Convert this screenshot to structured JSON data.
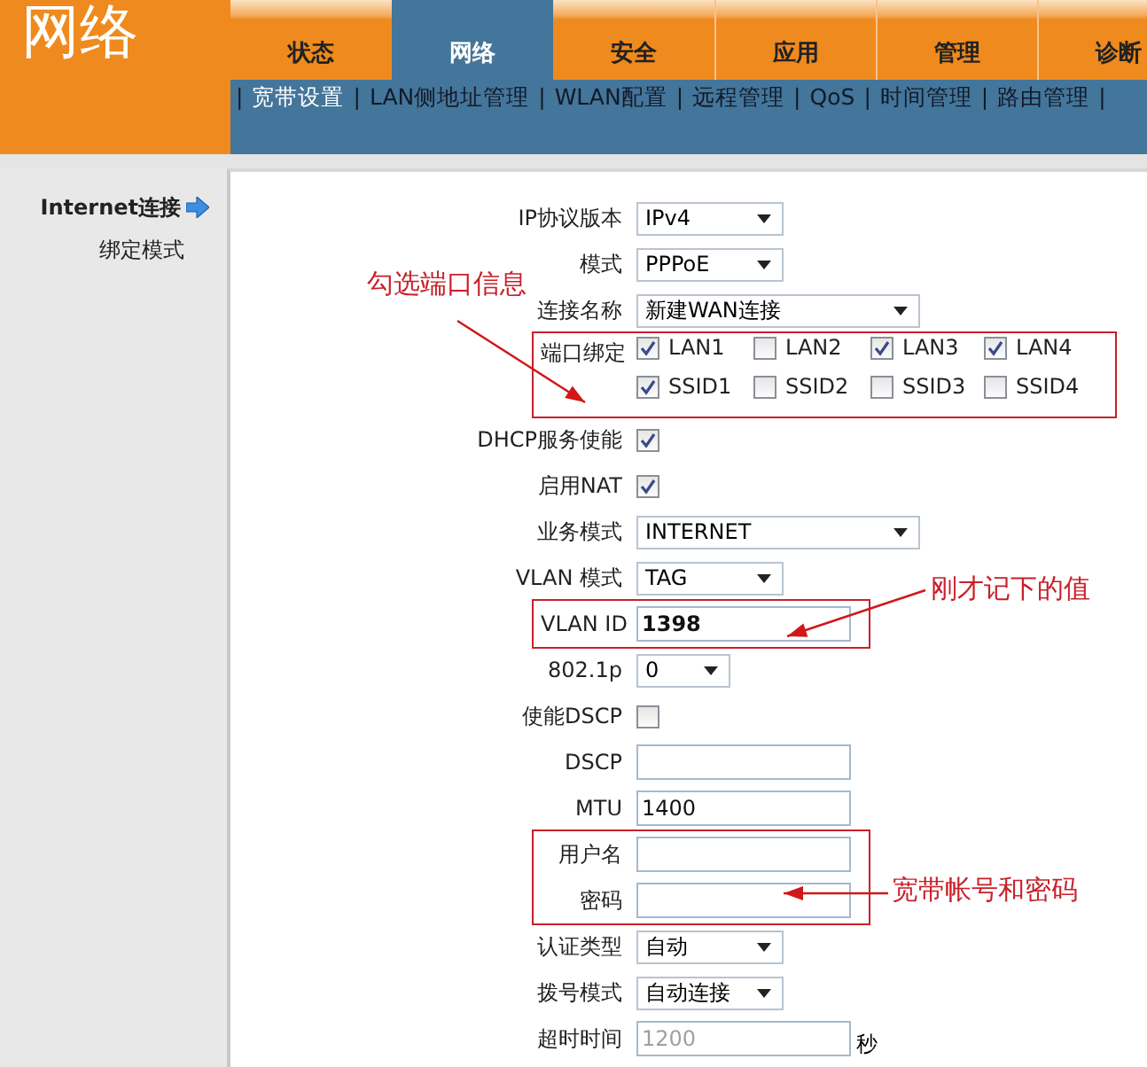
{
  "logo": {
    "title": "网络"
  },
  "tabs": [
    {
      "label": "状态",
      "selected": false
    },
    {
      "label": "网络",
      "selected": true
    },
    {
      "label": "安全",
      "selected": false
    },
    {
      "label": "应用",
      "selected": false
    },
    {
      "label": "管理",
      "selected": false
    },
    {
      "label": "诊断",
      "selected": false
    }
  ],
  "subnav": {
    "separator": "|",
    "items": [
      {
        "label": "宽带设置",
        "selected": true
      },
      {
        "label": "LAN侧地址管理",
        "selected": false
      },
      {
        "label": "WLAN配置",
        "selected": false
      },
      {
        "label": "远程管理",
        "selected": false
      },
      {
        "label": "QoS",
        "selected": false
      },
      {
        "label": "时间管理",
        "selected": false
      },
      {
        "label": "路由管理",
        "selected": false
      }
    ]
  },
  "sidebar": {
    "items": [
      {
        "label": "Internet连接",
        "selected": true
      },
      {
        "label": "绑定模式",
        "selected": false
      }
    ]
  },
  "form": {
    "groups": [
      {
        "highlighted": false,
        "rows": [
          {
            "kind": "select",
            "label": "IP协议版本",
            "value": "IPv4"
          },
          {
            "kind": "select",
            "label": "模式",
            "value": "PPPoE"
          },
          {
            "kind": "select",
            "label": "连接名称",
            "value": "新建WAN连接"
          }
        ]
      },
      {
        "highlighted": true,
        "rows": [
          {
            "kind": "checkboxes",
            "label": "端口绑定",
            "options": [
              {
                "label": "LAN1",
                "checked": true
              },
              {
                "label": "LAN2",
                "checked": false
              },
              {
                "label": "LAN3",
                "checked": true
              },
              {
                "label": "LAN4",
                "checked": true
              },
              {
                "label": "SSID1",
                "checked": true
              },
              {
                "label": "SSID2",
                "checked": false
              },
              {
                "label": "SSID3",
                "checked": false
              },
              {
                "label": "SSID4",
                "checked": false
              }
            ]
          }
        ]
      },
      {
        "highlighted": false,
        "rows": [
          {
            "kind": "checkbox",
            "label": "DHCP服务使能",
            "checked": true
          },
          {
            "kind": "checkbox",
            "label": "启用NAT",
            "checked": true
          },
          {
            "kind": "select",
            "label": "业务模式",
            "value": "INTERNET"
          },
          {
            "kind": "select",
            "label": "VLAN 模式",
            "value": "TAG"
          }
        ]
      },
      {
        "highlighted": true,
        "rows": [
          {
            "kind": "text",
            "label": "VLAN ID",
            "value": "1398",
            "bold": true
          }
        ]
      },
      {
        "highlighted": false,
        "rows": [
          {
            "kind": "select",
            "label": "802.1p",
            "value": "0"
          },
          {
            "kind": "checkbox",
            "label": "使能DSCP",
            "checked": false
          },
          {
            "kind": "text",
            "label": "DSCP"
          },
          {
            "kind": "text",
            "label": "MTU",
            "value": "1400"
          }
        ]
      },
      {
        "highlighted": true,
        "rows": [
          {
            "kind": "text",
            "label": "用户名"
          },
          {
            "kind": "text",
            "label": "密码"
          }
        ]
      },
      {
        "highlighted": false,
        "rows": [
          {
            "kind": "select",
            "label": "认证类型",
            "value": "自动"
          },
          {
            "kind": "select",
            "label": "拨号模式",
            "value": "自动连接"
          },
          {
            "kind": "text",
            "label": "超时时间",
            "value": "1200",
            "disabled": true,
            "unit": "秒"
          }
        ]
      }
    ]
  },
  "annotations": [
    {
      "text": "勾选端口信息"
    },
    {
      "text": "刚才记下的值"
    },
    {
      "text": "宽带帐号和密码"
    }
  ]
}
